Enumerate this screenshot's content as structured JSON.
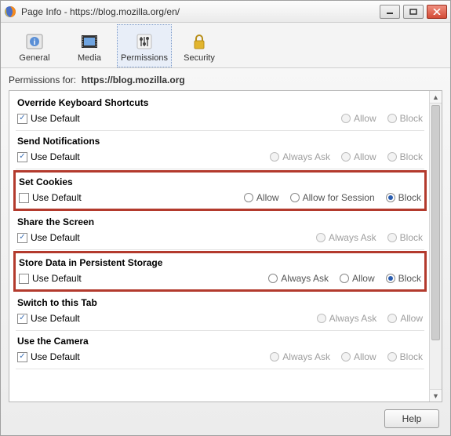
{
  "window": {
    "title": "Page Info - https://blog.mozilla.org/en/"
  },
  "tabs": {
    "general": "General",
    "media": "Media",
    "permissions": "Permissions",
    "security": "Security"
  },
  "permissions_for_label": "Permissions for:",
  "permissions_for_url": "https://blog.mozilla.org",
  "use_default_label": "Use Default",
  "option_labels": {
    "allow": "Allow",
    "block": "Block",
    "always_ask": "Always Ask",
    "allow_for_session": "Allow for Session"
  },
  "rows": [
    {
      "id": "override-keyboard-shortcuts",
      "title": "Override Keyboard Shortcuts",
      "use_default": true,
      "highlight": false,
      "options": [
        "allow",
        "block"
      ],
      "selected": null,
      "disabled": true
    },
    {
      "id": "send-notifications",
      "title": "Send Notifications",
      "use_default": true,
      "highlight": false,
      "options": [
        "always_ask",
        "allow",
        "block"
      ],
      "selected": null,
      "disabled": true
    },
    {
      "id": "set-cookies",
      "title": "Set Cookies",
      "use_default": false,
      "highlight": true,
      "options": [
        "allow",
        "allow_for_session",
        "block"
      ],
      "selected": "block",
      "disabled": false
    },
    {
      "id": "share-screen",
      "title": "Share the Screen",
      "use_default": true,
      "highlight": false,
      "options": [
        "always_ask",
        "block"
      ],
      "selected": null,
      "disabled": true
    },
    {
      "id": "store-data-persistent",
      "title": "Store Data in Persistent Storage",
      "use_default": false,
      "highlight": true,
      "options": [
        "always_ask",
        "allow",
        "block"
      ],
      "selected": "block",
      "disabled": false
    },
    {
      "id": "switch-to-tab",
      "title": "Switch to this Tab",
      "use_default": true,
      "highlight": false,
      "options": [
        "always_ask",
        "allow"
      ],
      "selected": null,
      "disabled": true
    },
    {
      "id": "use-camera",
      "title": "Use the Camera",
      "use_default": true,
      "highlight": false,
      "options": [
        "always_ask",
        "allow",
        "block"
      ],
      "selected": null,
      "disabled": true
    }
  ],
  "help_label": "Help"
}
